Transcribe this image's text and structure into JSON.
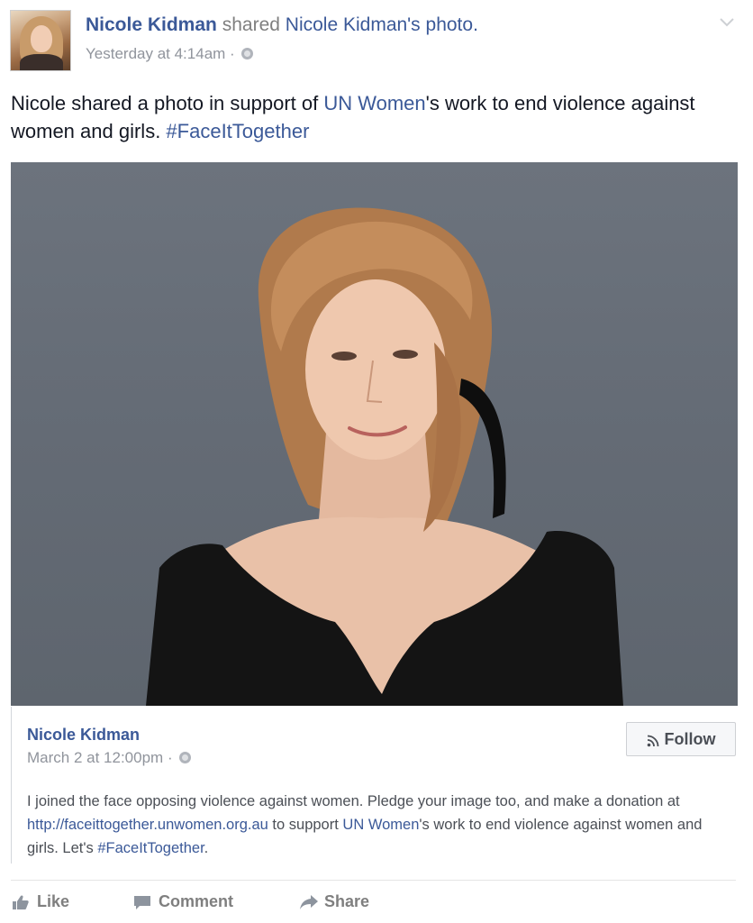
{
  "post": {
    "author": "Nicole Kidman",
    "verb": "shared",
    "object": "Nicole Kidman's photo.",
    "timestamp": "Yesterday at 4:14am",
    "caption_parts": {
      "p1": "Nicole shared a photo in support of ",
      "link1": "UN Women",
      "p2": "'s work to end violence against women and girls. ",
      "hashtag": "#FaceItTogether"
    }
  },
  "attachment": {
    "author": "Nicole Kidman",
    "timestamp": "March 2 at 12:00pm",
    "follow_label": "Follow",
    "text_parts": {
      "t1": "I joined the face opposing violence against women. Pledge your image too, and make a donation at ",
      "url": "http://faceittogether.unwomen.org.au",
      "t2": " to support ",
      "org": "UN Women",
      "t3": "'s work to end violence against women and girls. Let's ",
      "hashtag": "#FaceItTogether",
      "t4": "."
    }
  },
  "actions": {
    "like": "Like",
    "comment": "Comment",
    "share": "Share"
  },
  "icons": {
    "chevron": "chevron-down-icon",
    "globe": "globe-icon",
    "rss": "rss-icon",
    "like": "thumbs-up-icon",
    "comment": "comment-icon",
    "share": "share-arrow-icon"
  },
  "colors": {
    "link": "#3b5998",
    "meta": "#90949c",
    "action": "#7f7f7f"
  }
}
